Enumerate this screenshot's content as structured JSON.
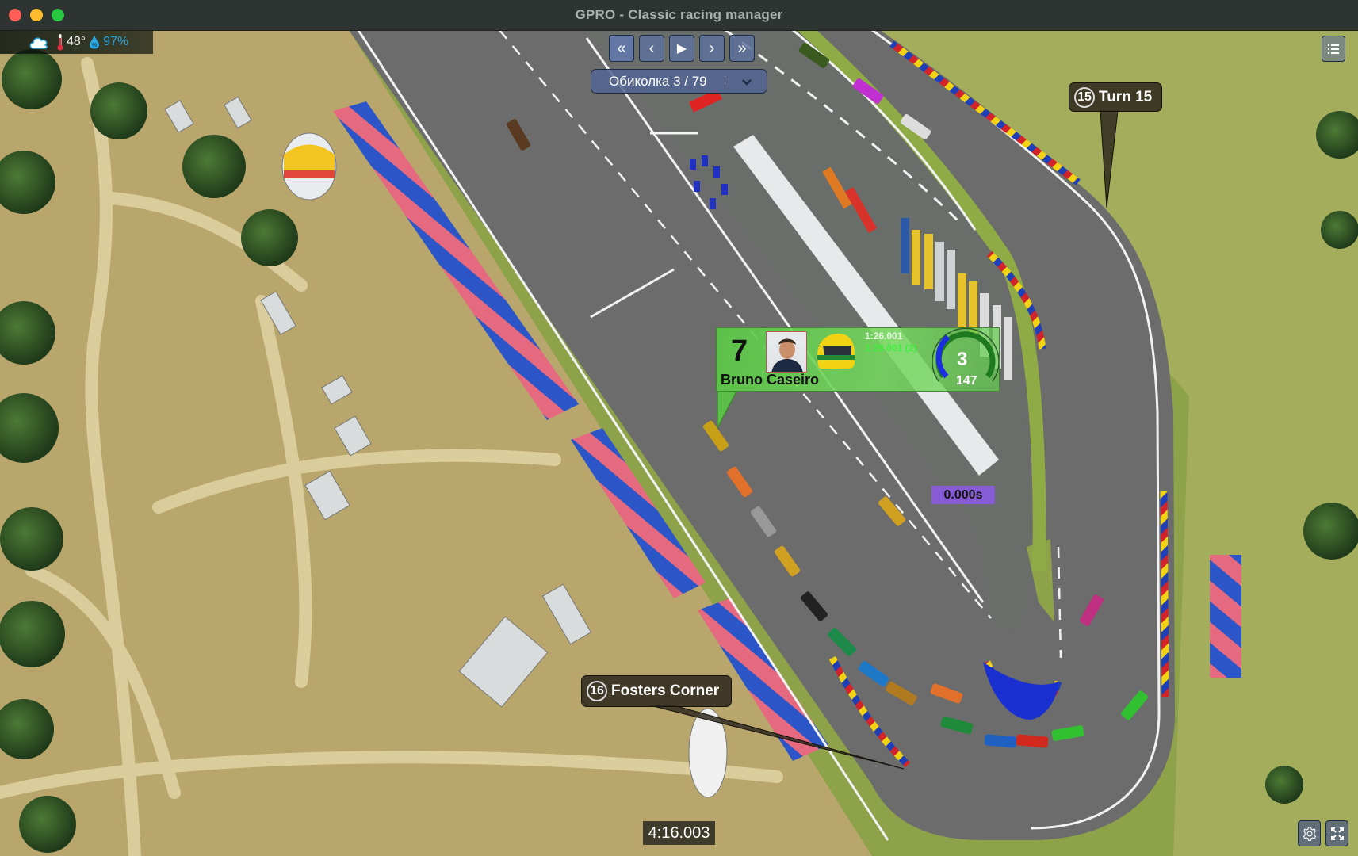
{
  "window": {
    "title": "GPRO - Classic racing manager"
  },
  "weather": {
    "condition_icon": "cloud-icon",
    "temperature": "48°",
    "humidity": "97%"
  },
  "playback": {
    "buttons": [
      {
        "name": "skip-back-button",
        "glyph": "«",
        "icon": "double-chevron-left-icon"
      },
      {
        "name": "step-back-button",
        "glyph": "‹",
        "icon": "chevron-left-icon"
      },
      {
        "name": "play-button",
        "glyph": "▶",
        "icon": "play-icon"
      },
      {
        "name": "step-forward-button",
        "glyph": "›",
        "icon": "chevron-right-icon"
      },
      {
        "name": "skip-forward-button",
        "glyph": "»",
        "icon": "double-chevron-right-icon"
      }
    ],
    "lap_label": "Обиколка 3 / 79",
    "lap_current": 3,
    "lap_total": 79
  },
  "corners": [
    {
      "number": "15",
      "name": "Turn 15"
    },
    {
      "number": "16",
      "name": "Fosters Corner"
    }
  ],
  "driver_card": {
    "car_number": "7",
    "driver_name": "Bruno Caseiro",
    "last_lap": "1:26.001",
    "best_lap": "1:26.001 (2)",
    "position": "3",
    "speed": "147",
    "gauge_fraction": 0.35,
    "colors": {
      "card": "#5ac846",
      "gauge_active": "#1a2ee0",
      "gauge_track": "#1f7a1f"
    }
  },
  "gap": "0.000s",
  "race_time": "4:16.003",
  "toolbar": {
    "menu_icon": "list-icon",
    "settings_icon": "gear-icon",
    "fullscreen_icon": "expand-icon"
  },
  "colors": {
    "asphalt": "#6b6c6b",
    "grass": "#8ea24a",
    "sand": "#c8b27a",
    "kerb_red": "#d3232a",
    "kerb_yellow": "#f2d313",
    "kerb_blue": "#1e3fb5",
    "control_bg": "#5c709c",
    "gap_bg": "#8c5ae6"
  }
}
